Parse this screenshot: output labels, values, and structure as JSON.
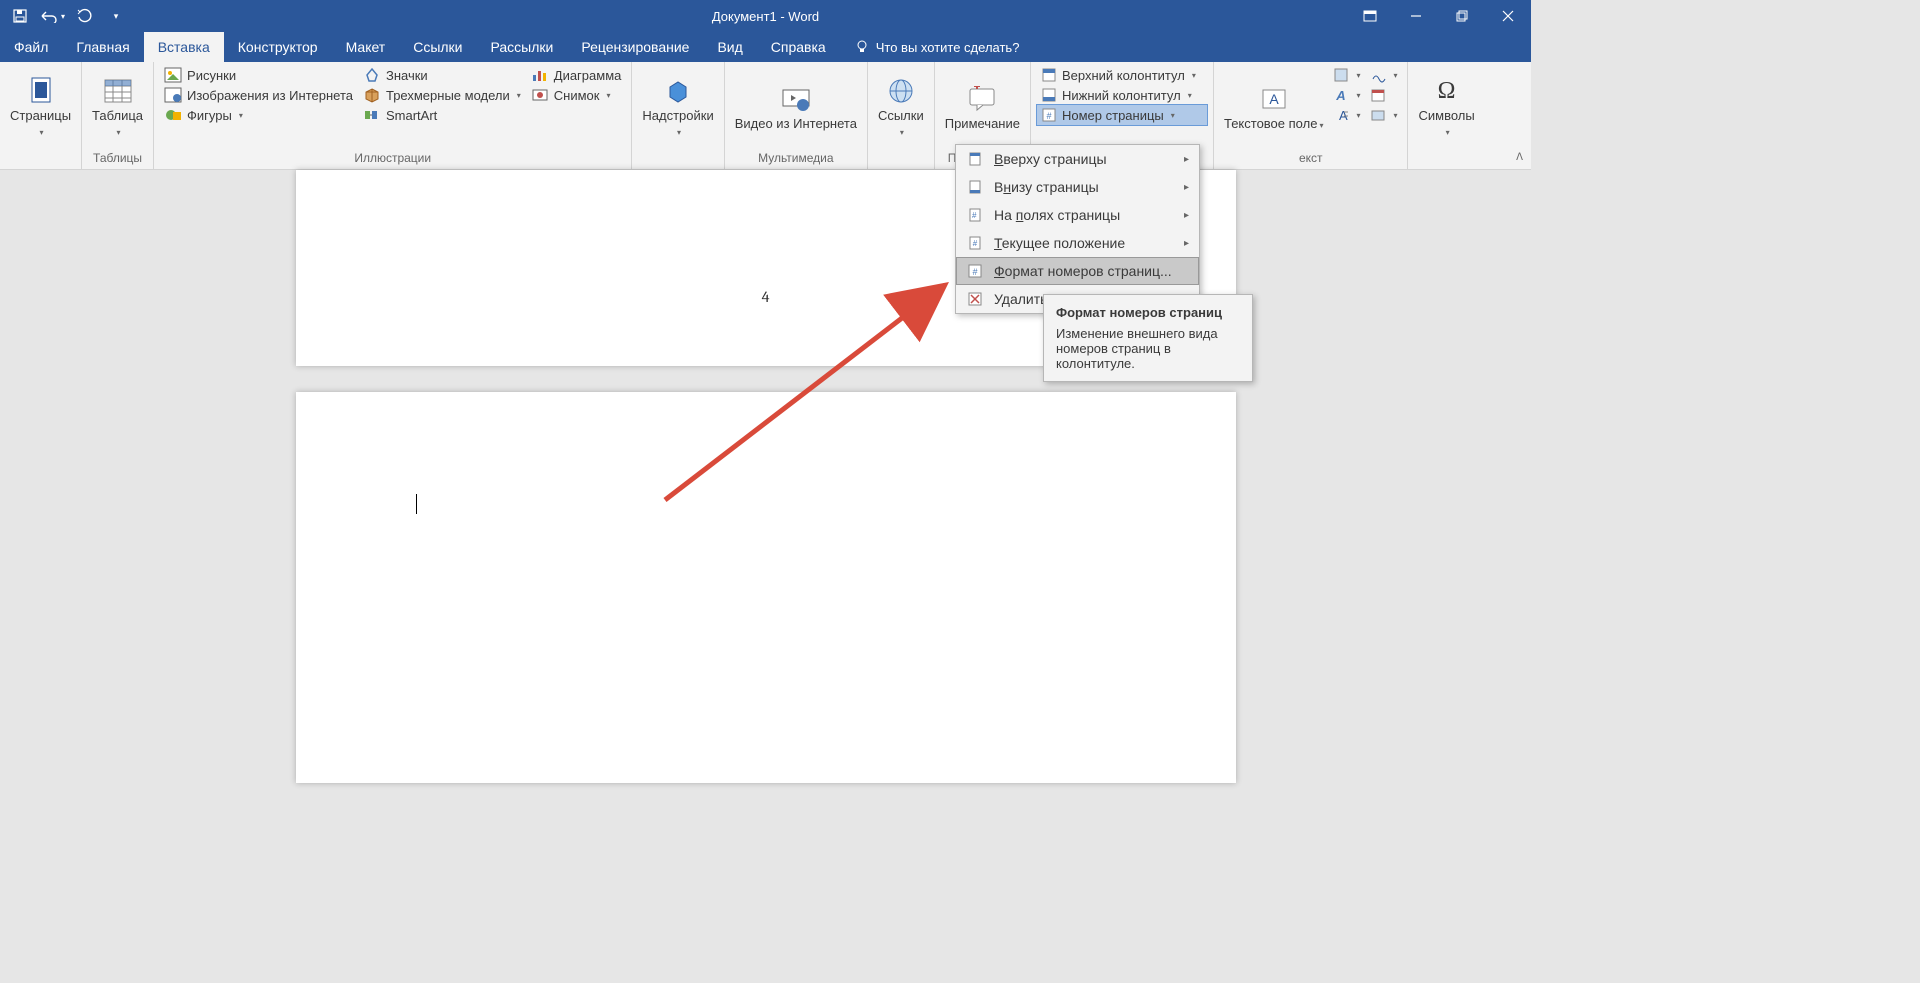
{
  "title": "Документ1  -  Word",
  "tabs": {
    "file": "Файл",
    "home": "Главная",
    "insert": "Вставка",
    "design": "Конструктор",
    "layout": "Макет",
    "references": "Ссылки",
    "mailings": "Рассылки",
    "review": "Рецензирование",
    "view": "Вид",
    "help": "Справка"
  },
  "tellme": "Что вы хотите сделать?",
  "ribbon": {
    "pages": {
      "label": "Страницы",
      "btn": "Страницы"
    },
    "tables": {
      "label": "Таблицы",
      "btn": "Таблица"
    },
    "illustrations": {
      "label": "Иллюстрации",
      "pictures": "Рисунки",
      "online": "Изображения из Интернета",
      "shapes": "Фигуры",
      "icons": "Значки",
      "models": "Трехмерные модели",
      "smartart": "SmartArt",
      "chart": "Диаграмма",
      "screenshot": "Снимок"
    },
    "addins": {
      "btn": "Надстройки"
    },
    "media": {
      "label": "Мультимедиа",
      "btn": "Видео из Интернета"
    },
    "links": {
      "btn": "Ссылки"
    },
    "comments": {
      "label": "Примечания",
      "btn": "Примечание"
    },
    "headerfooter": {
      "header": "Верхний колонтитул",
      "footer": "Нижний колонтитул",
      "pagenum": "Номер страницы"
    },
    "text": {
      "label": "екст",
      "btn": "Текстовое поле"
    },
    "symbols": {
      "btn": "Символы"
    }
  },
  "dropdown": {
    "top": "Вверху страницы",
    "bottom": "Внизу страницы",
    "margins": "На полях страницы",
    "current": "Текущее положение",
    "format": "Формат номеров страниц...",
    "remove": "Удалить"
  },
  "tooltip": {
    "title": "Формат номеров страниц",
    "body": "Изменение внешнего вида номеров страниц в колонтитуле."
  },
  "pagenumber": "4"
}
